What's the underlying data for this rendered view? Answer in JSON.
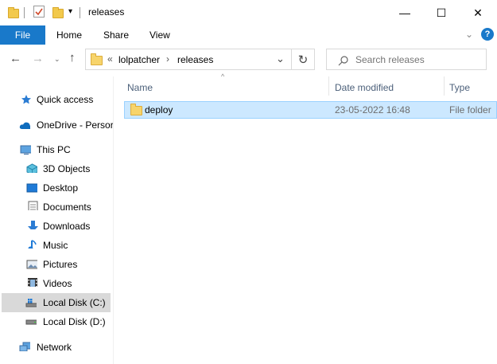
{
  "window": {
    "title": "releases",
    "minimize": "—",
    "maximize": "☐",
    "close": "✕"
  },
  "ribbon": {
    "tabs": [
      "File",
      "Home",
      "Share",
      "View"
    ],
    "help": "?"
  },
  "address": {
    "overflow": "«",
    "crumbs": [
      "lolpatcher",
      "releases"
    ],
    "separator": "›"
  },
  "search": {
    "placeholder": "Search releases"
  },
  "nav": {
    "quick_access": "Quick access",
    "onedrive": "OneDrive - Persor",
    "this_pc": "This PC",
    "items": [
      "3D Objects",
      "Desktop",
      "Documents",
      "Downloads",
      "Music",
      "Pictures",
      "Videos",
      "Local Disk (C:)",
      "Local Disk (D:)"
    ],
    "network": "Network"
  },
  "columns": {
    "name": "Name",
    "date": "Date modified",
    "type": "Type"
  },
  "files": [
    {
      "name": "deploy",
      "date": "23-05-2022 16:48",
      "type": "File folder"
    }
  ],
  "colors": {
    "accent": "#1979ca",
    "selection": "#cce8ff",
    "folder": "#f7d46b"
  }
}
